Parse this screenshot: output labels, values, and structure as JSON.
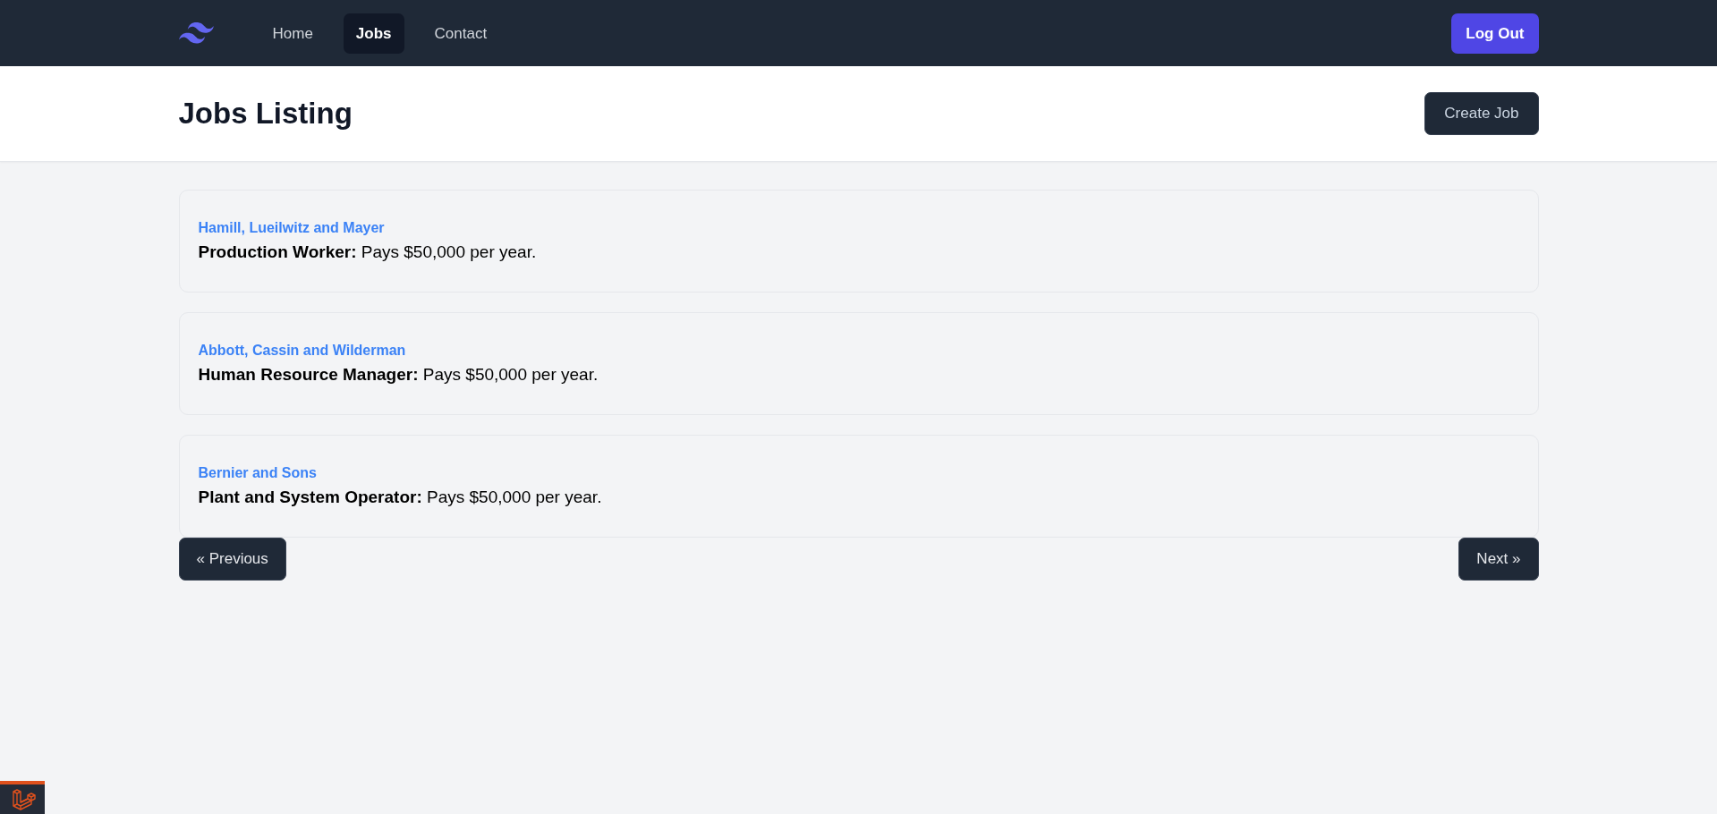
{
  "navbar": {
    "links": [
      {
        "label": "Home",
        "selected": false
      },
      {
        "label": "Jobs",
        "selected": true
      },
      {
        "label": "Contact",
        "selected": false
      }
    ],
    "logout_button": "Log Out"
  },
  "header": {
    "title": "Jobs Listing",
    "create_button": "Create Job"
  },
  "jobs": [
    {
      "company": "Hamill, Lueilwitz and Mayer",
      "text": "**Production Worker:** Pays $50,000 per year."
    },
    {
      "company": "Abbott, Cassin and Wilderman",
      "text": "**Human Resource Manager:** Pays $50,000 per year."
    },
    {
      "company": "Bernier and Sons",
      "text": "**Plant and System Operator:** Pays $50,000 per year."
    }
  ],
  "pagination": {
    "previous": "« Previous",
    "next": "Next »"
  }
}
